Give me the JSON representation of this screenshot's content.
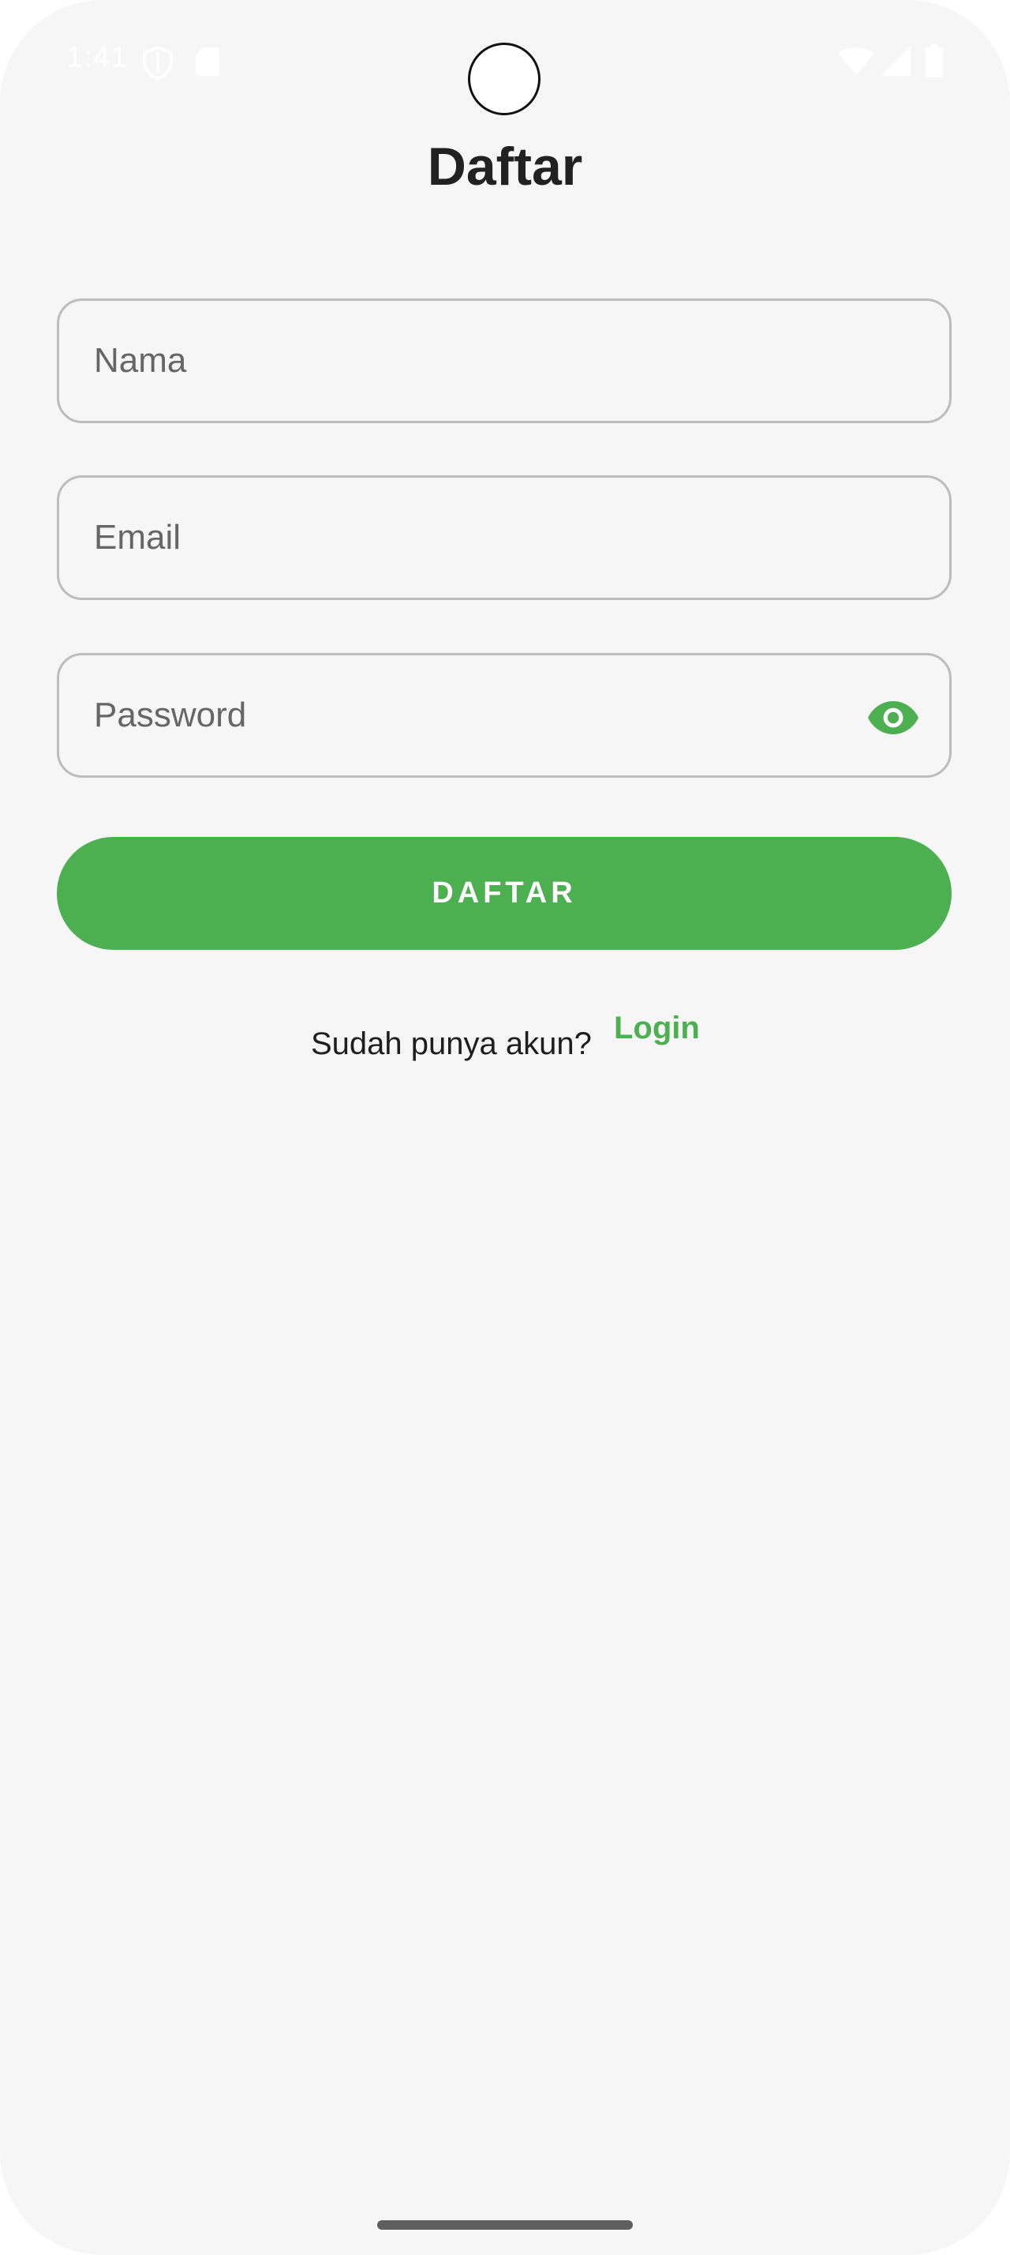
{
  "status_bar": {
    "time": "1:41",
    "icons": [
      "shield-icon",
      "sd-card-icon",
      "wifi-icon",
      "cell-signal-icon",
      "battery-icon"
    ]
  },
  "screen": {
    "title": "Daftar"
  },
  "form": {
    "name_placeholder": "Nama",
    "email_placeholder": "Email",
    "password_placeholder": "Password",
    "password_toggle_icon": "eye-icon",
    "submit_label": "DAFTAR"
  },
  "footer": {
    "question": "Sudah punya akun?",
    "login_link": "Login"
  },
  "colors": {
    "accent": "#4caf50",
    "background": "#f6f6f6",
    "field_border": "#bdbdbd",
    "title_text": "#212121"
  }
}
